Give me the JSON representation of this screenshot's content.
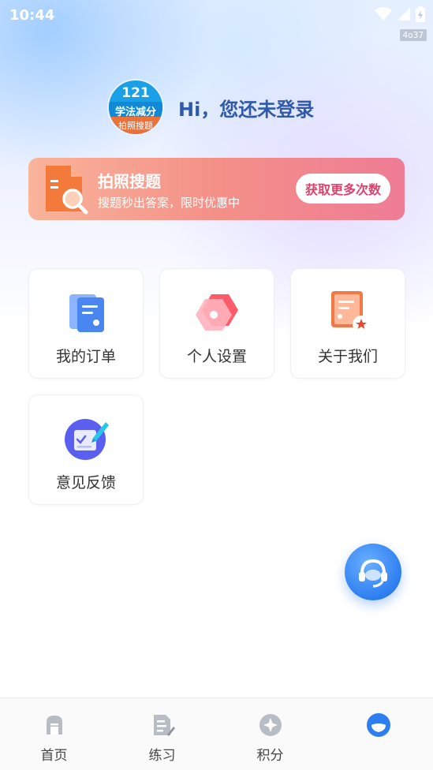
{
  "status_bar": {
    "time": "10:44",
    "tag": "4o37",
    "icons": [
      "wifi-icon",
      "signal-icon",
      "battery-icon"
    ]
  },
  "profile": {
    "avatar": {
      "line1": "121",
      "line2": "学法减分",
      "line3": "拍照搜题"
    },
    "greeting": "Hi，您还未登录"
  },
  "banner": {
    "title": "拍照搜题",
    "subtitle": "搜题秒出答案，限时优惠中",
    "button": "获取更多次数",
    "icon": "document-search-icon"
  },
  "menu": [
    {
      "label": "我的订单",
      "icon": "order-icon"
    },
    {
      "label": "个人设置",
      "icon": "settings-hexagon-icon"
    },
    {
      "label": "关于我们",
      "icon": "about-certificate-icon"
    },
    {
      "label": "意见反馈",
      "icon": "feedback-edit-icon"
    }
  ],
  "fab": {
    "icon": "customer-service-headset-icon"
  },
  "tabbar": [
    {
      "label": "首页",
      "icon": "home-icon",
      "active": false
    },
    {
      "label": "练习",
      "icon": "practice-icon",
      "active": false
    },
    {
      "label": "积分",
      "icon": "points-icon",
      "active": false
    },
    {
      "label": "",
      "icon": "profile-icon",
      "active": true
    }
  ],
  "colors": {
    "primary_blue": "#2d7ef0",
    "greeting_text": "#2f5aa8",
    "banner_start": "#f9b49a",
    "banner_end": "#ee7c95",
    "banner_button_text": "#e0406c",
    "tab_inactive": "#b8bcc4"
  }
}
